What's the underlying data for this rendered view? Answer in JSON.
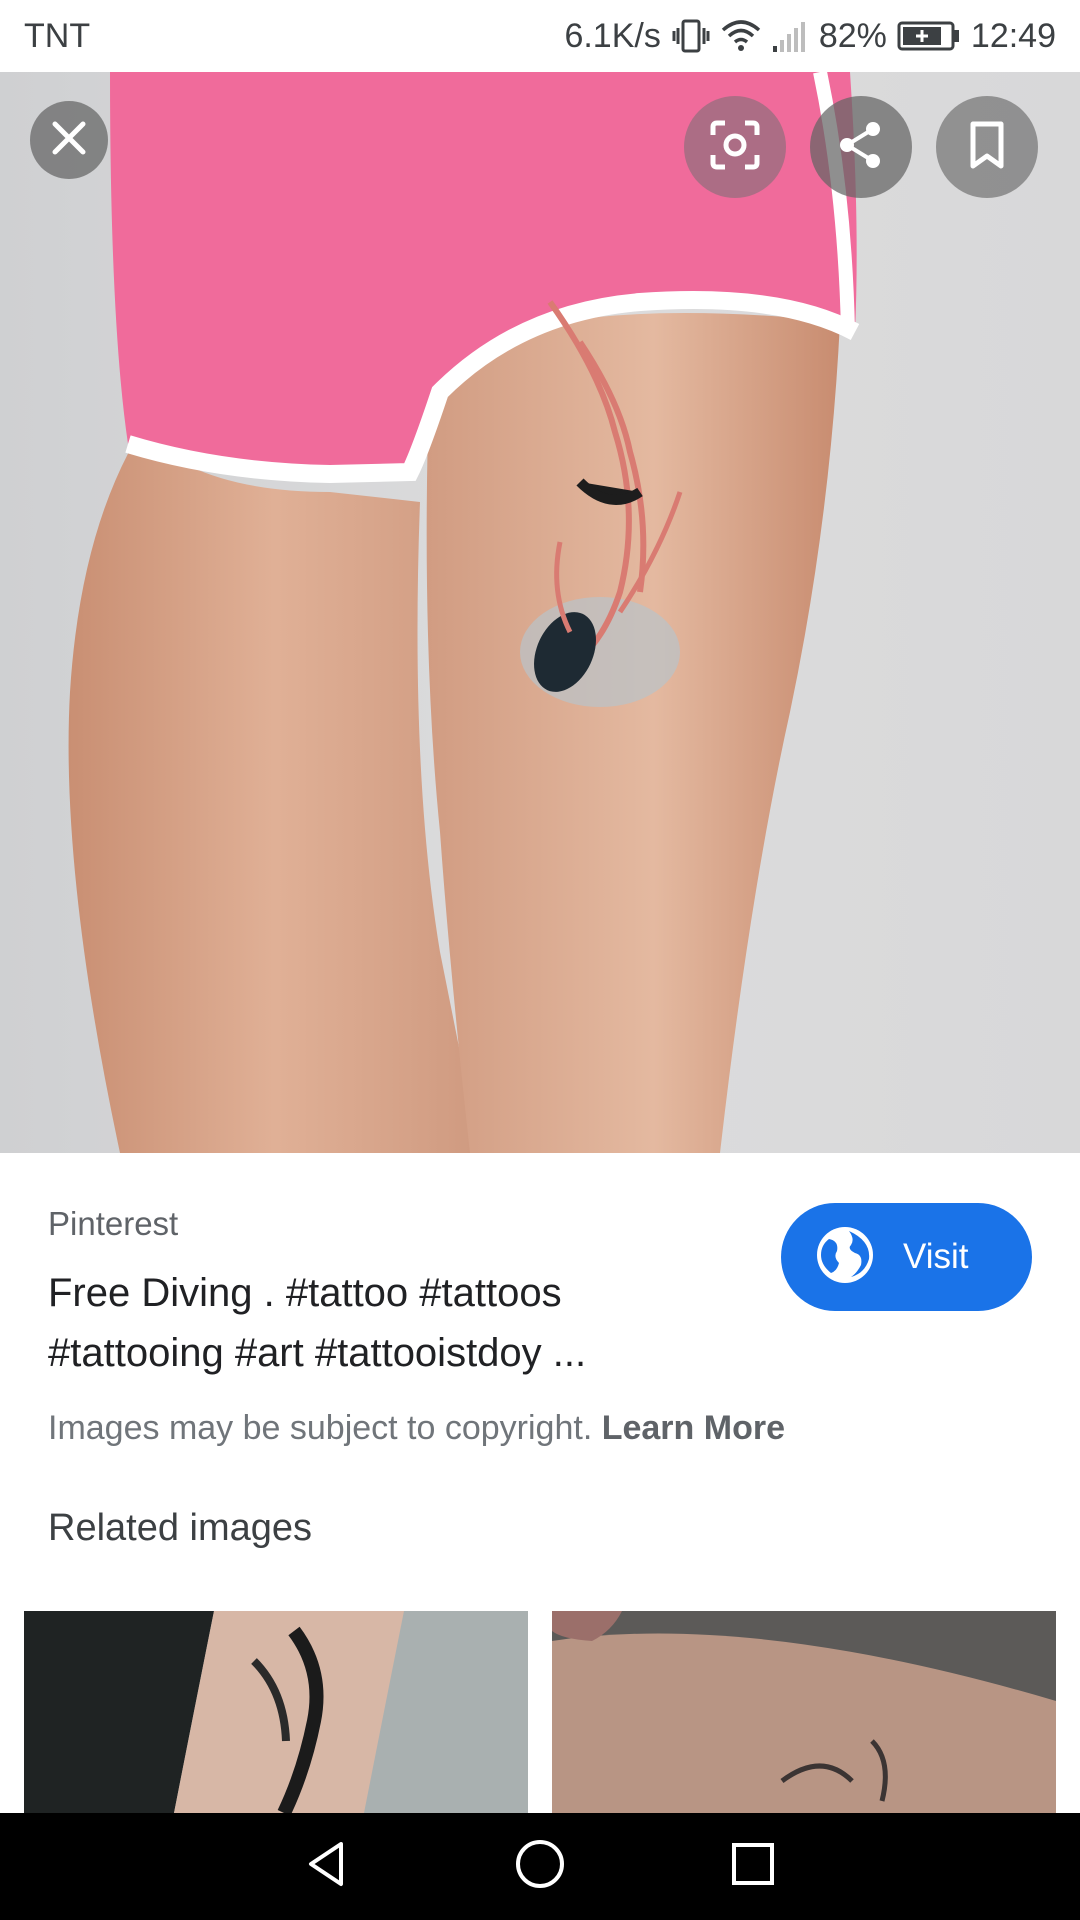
{
  "status_bar": {
    "carrier": "TNT",
    "network_speed": "6.1K/s",
    "battery_percent": "82%",
    "time": "12:49",
    "icons": [
      "vibrate-icon",
      "wifi-icon",
      "signal-icon",
      "battery-charging-icon"
    ]
  },
  "hero": {
    "icons": {
      "close": "close-icon",
      "lens": "lens-search-icon",
      "share": "share-icon",
      "save": "bookmark-icon"
    }
  },
  "result": {
    "source": "Pinterest",
    "title_line1": "Free Diving . #tattoo #tattoos",
    "title_line2": "#tattooing #art #tattooistdoy ...",
    "visit_label": "Visit",
    "visit_icon": "globe-icon",
    "copyright_text": "Images may be subject to copyright.",
    "learn_more": "Learn More",
    "related_title": "Related images"
  },
  "navigation": {
    "icons": [
      "back-icon",
      "home-icon",
      "recents-icon"
    ]
  },
  "colors": {
    "accent": "#1a73e8",
    "shorts_pink": "#f06b9b",
    "skin": "#d8a88e",
    "nav_bar": "#000000"
  }
}
